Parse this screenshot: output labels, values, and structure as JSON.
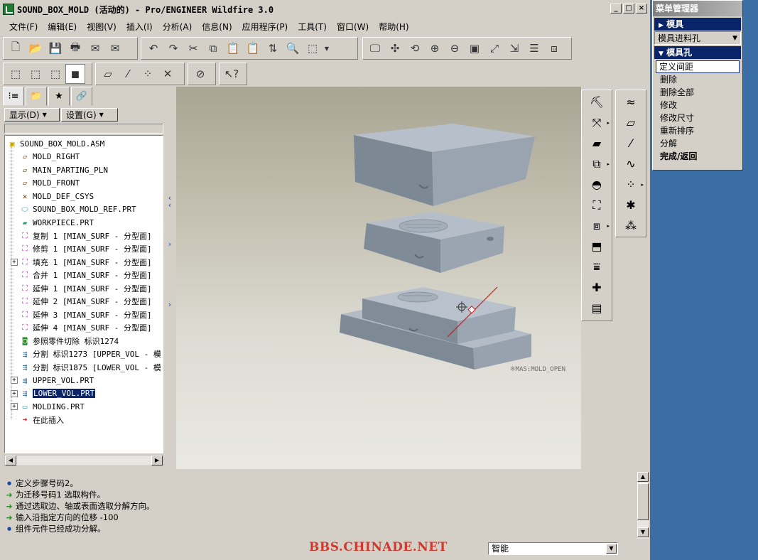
{
  "window": {
    "title": "SOUND_BOX_MOLD (活动的) - Pro/ENGINEER Wildfire 3.0",
    "controls": [
      "_",
      "□",
      "×"
    ]
  },
  "menubar": [
    "文件(F)",
    "编辑(E)",
    "视图(V)",
    "插入(I)",
    "分析(A)",
    "信息(N)",
    "应用程序(P)",
    "工具(T)",
    "窗口(W)",
    "帮助(H)"
  ],
  "navigator": {
    "show_label": "显示(D)",
    "settings_label": "设置(G)",
    "tree": [
      {
        "label": "SOUND_BOX_MOLD.ASM",
        "icon": "assembly-icon",
        "indent": 0,
        "expand": ""
      },
      {
        "label": "MOLD_RIGHT",
        "icon": "datum-plane-icon",
        "indent": 1,
        "expand": ""
      },
      {
        "label": "MAIN_PARTING_PLN",
        "icon": "datum-plane-icon",
        "indent": 1,
        "expand": ""
      },
      {
        "label": "MOLD_FRONT",
        "icon": "datum-plane-icon",
        "indent": 1,
        "expand": ""
      },
      {
        "label": "MOLD_DEF_CSYS",
        "icon": "csys-icon",
        "indent": 1,
        "expand": ""
      },
      {
        "label": "SOUND_BOX_MOLD_REF.PRT",
        "icon": "ref-part-icon",
        "indent": 1,
        "expand": ""
      },
      {
        "label": "WORKPIECE.PRT",
        "icon": "workpiece-icon",
        "indent": 1,
        "expand": ""
      },
      {
        "label": "复制 1 [MIAN_SURF - 分型面]",
        "icon": "surface-icon",
        "indent": 1,
        "expand": ""
      },
      {
        "label": "修剪 1 [MIAN_SURF - 分型面]",
        "icon": "surface-icon",
        "indent": 1,
        "expand": ""
      },
      {
        "label": "填充 1 [MIAN_SURF - 分型面]",
        "icon": "surface-icon",
        "indent": 1,
        "expand": "+"
      },
      {
        "label": "合并 1 [MIAN_SURF - 分型面]",
        "icon": "surface-icon",
        "indent": 1,
        "expand": ""
      },
      {
        "label": "延伸 1 [MIAN_SURF - 分型面]",
        "icon": "surface-icon",
        "indent": 1,
        "expand": ""
      },
      {
        "label": "延伸 2 [MIAN_SURF - 分型面]",
        "icon": "surface-icon",
        "indent": 1,
        "expand": ""
      },
      {
        "label": "延伸 3 [MIAN_SURF - 分型面]",
        "icon": "surface-icon",
        "indent": 1,
        "expand": ""
      },
      {
        "label": "延伸 4 [MIAN_SURF - 分型面]",
        "icon": "surface-icon",
        "indent": 1,
        "expand": ""
      },
      {
        "label": "参照零件切除 标识1274",
        "icon": "ref-cut-icon",
        "indent": 1,
        "expand": ""
      },
      {
        "label": "分割 标识1273 [UPPER_VOL - 模",
        "icon": "split-icon",
        "indent": 1,
        "expand": ""
      },
      {
        "label": "分割 标识1875 [LOWER_VOL - 模",
        "icon": "split-icon",
        "indent": 1,
        "expand": ""
      },
      {
        "label": "UPPER_VOL.PRT",
        "icon": "mold-volume-icon",
        "indent": 1,
        "expand": "+"
      },
      {
        "label": "LOWER_VOL.PRT",
        "icon": "mold-volume-icon",
        "indent": 1,
        "expand": "+",
        "selected": true
      },
      {
        "label": "MOLDING.PRT",
        "icon": "molding-icon",
        "indent": 1,
        "expand": "+"
      },
      {
        "label": "在此插入",
        "icon": "insert-here-icon",
        "indent": 1,
        "expand": ""
      }
    ]
  },
  "viewport": {
    "view_label": "※MAS:MOLD_OPEN"
  },
  "messages": [
    {
      "icon": "info-bullet-icon",
      "text": "定义步骤号码2。"
    },
    {
      "icon": "prompt-arrow-icon",
      "text": "为迁移号码1 选取构件。"
    },
    {
      "icon": "prompt-arrow-icon",
      "text": "通过选取边、轴或表面选取分解方向。"
    },
    {
      "icon": "prompt-arrow-icon",
      "text": "输入沿指定方向的位移    -100"
    },
    {
      "icon": "info-bullet-icon",
      "text": "组件元件已经成功分解。"
    }
  ],
  "status": {
    "watermark": "BBS.CHINADE.NET",
    "filter_value": "智能"
  },
  "menu_manager": {
    "title": "菜单管理器",
    "head_mold": "模具",
    "submenu_select": "模具进料孔",
    "head_mold_hole": "模具孔",
    "items": [
      "定义间距",
      "删除",
      "删除全部",
      "修改",
      "修改尺寸",
      "重新排序",
      "分解"
    ],
    "done_return": "完成/返回"
  },
  "colors": {
    "selection": "#0a246a",
    "desktop": "#3a6ea5",
    "part_gray": "#8e9aa6",
    "watermark_red": "#d03a2e"
  }
}
